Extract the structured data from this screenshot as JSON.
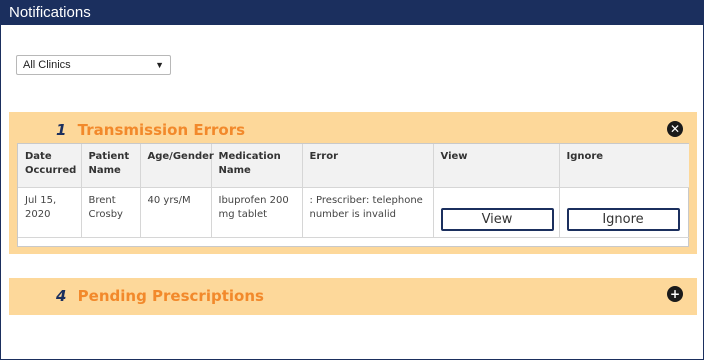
{
  "header": {
    "title": "Notifications"
  },
  "filter": {
    "clinic_selected": "All Clinics"
  },
  "transmission_errors": {
    "count": "1",
    "title": "Transmission Errors",
    "toggle_symbol": "✕",
    "columns": [
      "Date Occurred",
      "Patient Name",
      "Age/Gender",
      "Medication Name",
      "Error",
      "View",
      "Ignore"
    ],
    "rows": [
      {
        "date": "Jul 15, 2020",
        "patient": "Brent Crosby",
        "age_gender": "40 yrs/M",
        "medication": "Ibuprofen 200 mg tablet",
        "error": ": Prescriber: telephone number is invalid",
        "view_label": "View",
        "ignore_label": "Ignore"
      }
    ]
  },
  "pending_prescriptions": {
    "count": "4",
    "title": "Pending Prescriptions",
    "toggle_symbol": "+"
  },
  "colors": {
    "header_bg": "#1b2f5e",
    "panel_bg": "#fdd89a",
    "panel_title": "#f2892b",
    "count_color": "#1b2f5e"
  },
  "icons": {
    "collapse": "close-circle-icon",
    "expand": "plus-circle-icon",
    "dropdown": "chevron-down-icon"
  }
}
